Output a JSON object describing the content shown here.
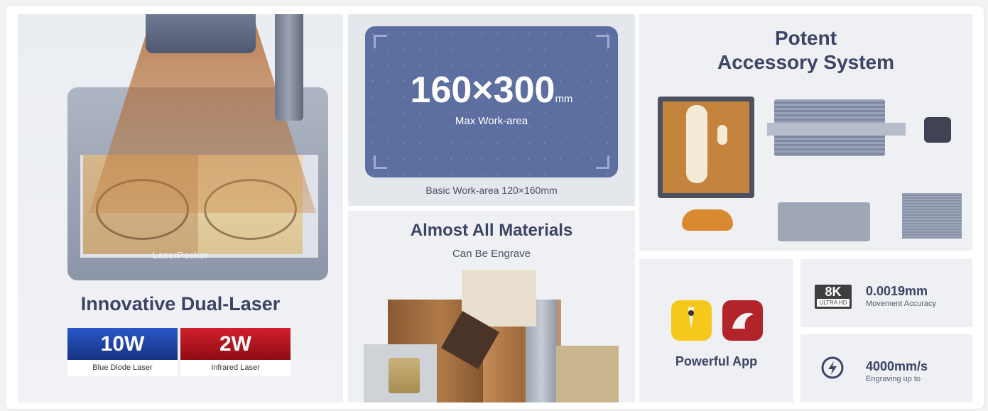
{
  "panel_dual_laser": {
    "brand": "LaserPecker",
    "title": "Innovative Dual-Laser",
    "lasers": [
      {
        "power": "10W",
        "name": "Blue Diode Laser",
        "color": "#1a3e9a"
      },
      {
        "power": "2W",
        "name": "Infrared Laser",
        "color": "#b0121c"
      }
    ]
  },
  "panel_work_area": {
    "size": "160×300",
    "unit": "mm",
    "label": "Max Work-area",
    "basic": "Basic Work-area 120×160mm"
  },
  "panel_materials": {
    "title": "Almost All Materials",
    "subtitle": "Can Be Engrave"
  },
  "panel_accessory": {
    "title_line1": "Potent",
    "title_line2": "Accessory System"
  },
  "panel_app": {
    "label": "Powerful App"
  },
  "panel_accuracy": {
    "badge_main": "8K",
    "badge_sub": "ULTRA HD",
    "value": "0.0019mm",
    "caption": "Movement Accuracy"
  },
  "panel_speed": {
    "value": "4000mm/s",
    "caption": "Engraving up to"
  },
  "colors": {
    "title": "#3c4466",
    "card": "#5d6fa1",
    "panel": "#eef0f3"
  }
}
